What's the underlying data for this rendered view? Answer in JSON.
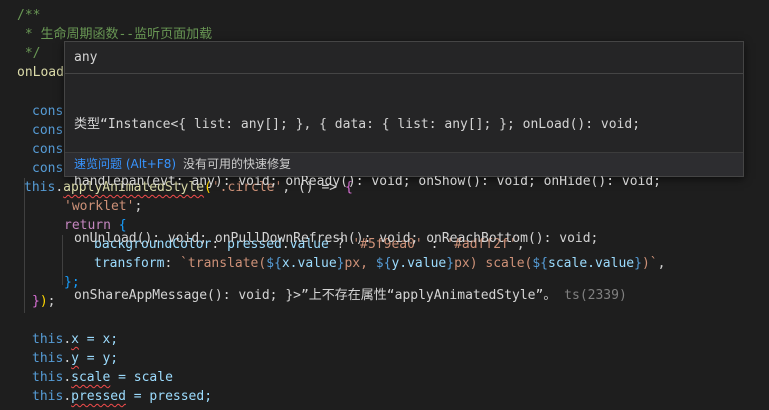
{
  "editor": {
    "lines": {
      "l1": "/**",
      "l2": " * 生命周期函数--监听页面加载",
      "l3": " */",
      "l4_name": "onLoad",
      "l6_kw": "const",
      "l7_kw": "const",
      "l8_kw": "const",
      "l9_kw": "const",
      "l10_this": "this",
      "l10_dot": ".",
      "l10_func": "applyAnimatedStyle",
      "l10_open": "(",
      "l10_str": "'.circle'",
      "l10_rest": ", () => ",
      "l10_brace": "{",
      "l11_str": "'worklet'",
      "l11_semi": ";",
      "l12_kw": "return",
      "l12_brace": " {",
      "l13_prop": "backgroundColor",
      "l13_a": ": ",
      "l13_var": "pressed",
      "l13_dot": ".",
      "l13_val": "value",
      "l13_q": " ? ",
      "l13_s1": "'#5f9ea0'",
      "l13_c": " : ",
      "l13_s2": "'#adff2f'",
      "l13_end": ",",
      "l14_prop": "transform",
      "l14_a": ": ",
      "l14_tpl1": "`translate(",
      "l14_i1": "${",
      "l14_v1": "x.value",
      "l14_e1": "}",
      "l14_tpl2": "px, ",
      "l14_i2": "${",
      "l14_v2": "y.value",
      "l14_e2": "}",
      "l14_tpl3": "px) scale(",
      "l14_i3": "${",
      "l14_v3": "scale.value",
      "l14_e3": "}",
      "l14_tpl4": ")`",
      "l14_end": ",",
      "l15": "};",
      "l16_brace": "}",
      "l16_paren": ")",
      "l16_semi": ";",
      "l18_this": "this",
      "l18_dot": ".",
      "l18_prop": "x",
      "l18_rest": " = x;",
      "l19_this": "this",
      "l19_dot": ".",
      "l19_prop": "y",
      "l19_rest": " = y;",
      "l20_this": "this",
      "l20_dot": ".",
      "l20_prop": "scale",
      "l20_rest": " = scale",
      "l21_this": "this",
      "l21_dot": ".",
      "l21_prop": "pressed",
      "l21_rest": " = pressed;"
    }
  },
  "hover": {
    "type": "any",
    "message_lines": [
      "类型“Instance<{ list: any[]; }, { data: { list: any[]; }; onLoad(): void;",
      "handlepan(evt: any): void; onReady(): void; onShow(): void; onHide(): void;",
      "onUnload(): void; onPullDownRefresh(): void; onReachBottom(): void;",
      "onShareAppMessage(): void; }>”上不存在属性“applyAnimatedStyle”。"
    ],
    "error_code": "ts(2339)",
    "peek_problem": "速览问题 (Alt+F8)",
    "no_quick_fix": "没有可用的快速修复"
  },
  "colors": {
    "background": "#1e1e1e",
    "comment": "#6a9955",
    "function": "#dcdcaa",
    "keyword": "#569cd6",
    "string": "#ce9178",
    "variable": "#9cdcfe",
    "error_squiggle": "#f14c4c",
    "link": "#3794ff"
  }
}
